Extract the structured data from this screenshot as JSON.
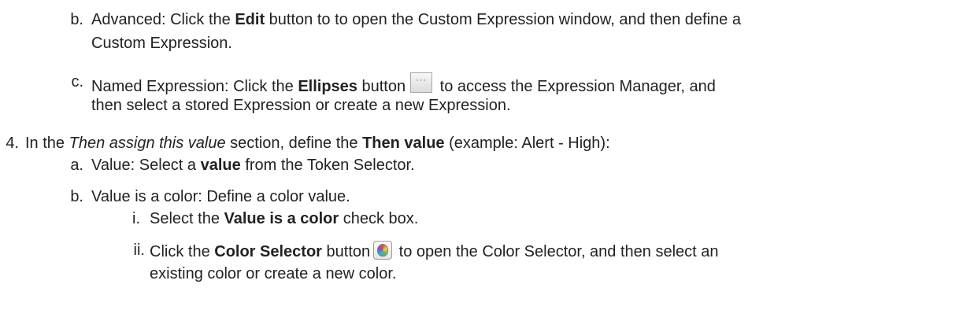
{
  "items": {
    "b_advanced": {
      "marker": "b.",
      "line1": {
        "pre": "Advanced: Click the ",
        "bold": "Edit",
        "post": " button to to open the Custom Expression window, and then define a"
      },
      "line2": "Custom Expression."
    },
    "c_named": {
      "marker": "c.",
      "line1": {
        "pre": "Named Expression: Click the ",
        "bold": "Ellipses",
        "mid": " button",
        "post": " to access the Expression Manager, and"
      },
      "line2": "then select a stored Expression or create a new Expression."
    },
    "step4": {
      "marker": "4.",
      "pre": "In the ",
      "italic": "Then assign this value",
      "mid": " section, define the ",
      "bold": "Then value",
      "post": " (example: Alert - High):"
    },
    "a_value": {
      "marker": "a.",
      "pre": "Value: Select a ",
      "bold": "value",
      "post": " from the Token Selector."
    },
    "b_color": {
      "marker": "b.",
      "text": "Value is a color: Define a color value."
    },
    "i_select": {
      "marker": "i.",
      "pre": "Select the ",
      "bold": "Value is a color",
      "post": " check box."
    },
    "ii_click": {
      "marker": "ii.",
      "line1": {
        "pre": "Click the ",
        "bold": "Color Selector",
        "mid": " button",
        "post": " to open the Color Selector, and then select an"
      },
      "line2": "existing color or create a new color."
    }
  },
  "icons": {
    "ellipses_button": "ellipsis-button-icon",
    "color_selector_button": "color-selector-icon"
  }
}
